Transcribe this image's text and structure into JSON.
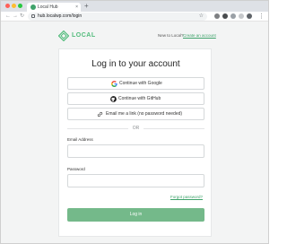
{
  "browser": {
    "tab_title": "Local Hub",
    "tab_close": "×",
    "new_tab": "+",
    "url": "hub.localwp.com/login",
    "nav": {
      "back": "←",
      "forward": "→",
      "reload": "↻"
    },
    "star": "☆",
    "menu": "⋮"
  },
  "brand": {
    "name": "LOCAL",
    "color": "#51bb7b"
  },
  "header": {
    "signup_prompt": "New to Local?",
    "signup_link": "Create an account"
  },
  "login": {
    "title": "Log in to your account",
    "providers": [
      {
        "label": "Continue with Google",
        "icon": "google-icon"
      },
      {
        "label": "Continue with GitHub",
        "icon": "github-icon"
      },
      {
        "label": "Email me a link (no password needed)",
        "icon": "link-icon"
      }
    ],
    "divider": "OR",
    "email_label": "Email Address",
    "email_value": "",
    "password_label": "Password",
    "password_value": "",
    "forgot": "Forgot password?",
    "submit": "Log in",
    "accent_color": "#74b98a"
  }
}
